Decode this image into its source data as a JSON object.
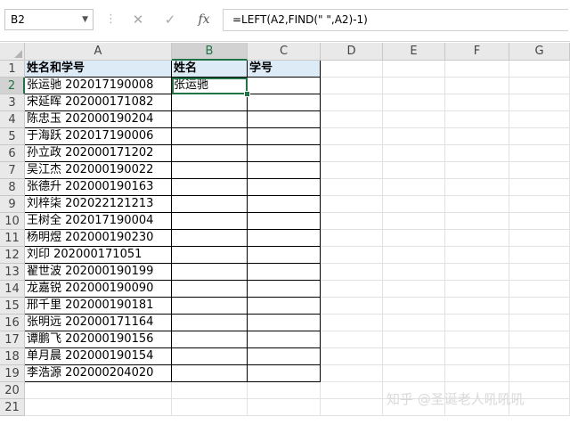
{
  "formula_bar": {
    "name_box": "B2",
    "cancel_glyph": "✕",
    "enter_glyph": "✓",
    "fx_label": "fx",
    "formula": "=LEFT(A2,FIND(\" \",A2)-1)"
  },
  "columns": [
    "A",
    "B",
    "C",
    "D",
    "E",
    "F",
    "G"
  ],
  "rows": [
    "1",
    "2",
    "3",
    "4",
    "5",
    "6",
    "7",
    "8",
    "9",
    "10",
    "11",
    "12",
    "13",
    "14",
    "15",
    "16",
    "17",
    "18",
    "19",
    "20",
    "21"
  ],
  "table": {
    "headers": [
      "姓名和学号",
      "姓名",
      "学号"
    ],
    "data": [
      [
        "张运驰 202017190008",
        "张运驰",
        ""
      ],
      [
        "宋延晖 202000171082",
        "",
        ""
      ],
      [
        "陈忠玉 202000190204",
        "",
        ""
      ],
      [
        "于海跃 202017190006",
        "",
        ""
      ],
      [
        "孙立政 202000171202",
        "",
        ""
      ],
      [
        "吴江杰 202000190022",
        "",
        ""
      ],
      [
        "张德升 202000190163",
        "",
        ""
      ],
      [
        "刘梓柒 202022121213",
        "",
        ""
      ],
      [
        "王树全 202017190004",
        "",
        ""
      ],
      [
        "杨明煜 202000190230",
        "",
        ""
      ],
      [
        "刘印 202000171051",
        "",
        ""
      ],
      [
        "翟世波 202000190199",
        "",
        ""
      ],
      [
        "龙嘉锐 202000190090",
        "",
        ""
      ],
      [
        "邢千里 202000190181",
        "",
        ""
      ],
      [
        "张明远 202000171164",
        "",
        ""
      ],
      [
        "谭鹏飞 202000190156",
        "",
        ""
      ],
      [
        "单月晨 202000190154",
        "",
        ""
      ],
      [
        "李浩源 202000204020",
        "",
        ""
      ]
    ]
  },
  "colors": {
    "header_fill": "#ddebf7",
    "selection": "#217346"
  },
  "watermark": "知乎 @圣诞老人吼吼吼"
}
